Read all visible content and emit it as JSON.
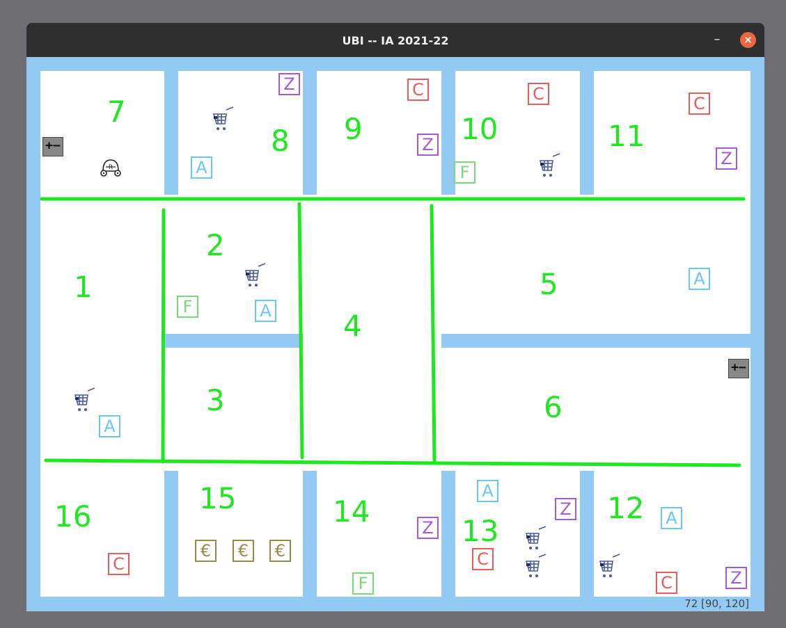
{
  "window": {
    "title": "UBI -- IA 2021-22",
    "minimize_label": "–",
    "close_label": "×"
  },
  "colors": {
    "room_number": "#1ee81e",
    "wall": "#92caf3",
    "tag_a": "#69c8f0",
    "tag_c": "#e85c5c",
    "tag_z": "#a45ad8",
    "tag_f": "#7ad87a",
    "tag_euro": "#9a8a4a"
  },
  "rooms": {
    "r1": "1",
    "r2": "2",
    "r3": "3",
    "r4": "4",
    "r5": "5",
    "r6": "6",
    "r7": "7",
    "r8": "8",
    "r9": "9",
    "r10": "10",
    "r11": "11",
    "r12": "12",
    "r13": "13",
    "r14": "14",
    "r15": "15",
    "r16": "16"
  },
  "tags": {
    "a": "A",
    "c": "C",
    "z": "Z",
    "f": "F",
    "euro": "€"
  },
  "icons": {
    "cart": "shopping-cart-icon",
    "robot": "robot-icon",
    "zoom": "zoom-plus-minus-icon"
  },
  "zoom_controls": {
    "label": "+−"
  },
  "status": {
    "text": "72  [90, 120]"
  }
}
